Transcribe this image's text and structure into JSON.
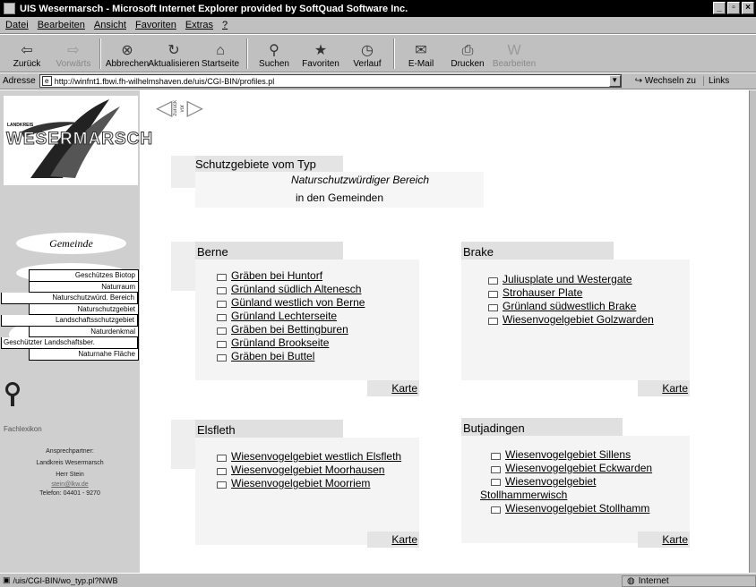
{
  "window": {
    "title": "UIS Wesermarsch - Microsoft Internet Explorer provided by SoftQuad Software Inc."
  },
  "menu": [
    "Datei",
    "Bearbeiten",
    "Ansicht",
    "Favoriten",
    "Extras",
    "?"
  ],
  "toolbar": [
    {
      "label": "Zurück",
      "icon": "back-arrow-icon",
      "glyph": "⇦",
      "enabled": true
    },
    {
      "label": "Vorwärts",
      "icon": "forward-arrow-icon",
      "glyph": "⇨",
      "enabled": false
    },
    {
      "label": "Abbrechen",
      "icon": "stop-icon",
      "glyph": "⊗",
      "enabled": true
    },
    {
      "label": "Aktualisieren",
      "icon": "refresh-icon",
      "glyph": "↻",
      "enabled": true
    },
    {
      "label": "Startseite",
      "icon": "home-icon",
      "glyph": "⌂",
      "enabled": true
    },
    {
      "label": "Suchen",
      "icon": "search-icon",
      "glyph": "⚲",
      "enabled": true
    },
    {
      "label": "Favoriten",
      "icon": "favorites-icon",
      "glyph": "★",
      "enabled": true
    },
    {
      "label": "Verlauf",
      "icon": "history-icon",
      "glyph": "◷",
      "enabled": true
    },
    {
      "label": "E-Mail",
      "icon": "mail-icon",
      "glyph": "✉",
      "enabled": true
    },
    {
      "label": "Drucken",
      "icon": "print-icon",
      "glyph": "⎙",
      "enabled": true
    },
    {
      "label": "Bearbeiten",
      "icon": "edit-icon",
      "glyph": "W",
      "enabled": false
    }
  ],
  "address": {
    "label": "Adresse",
    "url": "http://winfnt1.fbwi.fh-wilhelmshaven.de/uis/CGI-BIN/profiles.pl",
    "go": "Wechseln zu",
    "links": "Links"
  },
  "status": {
    "text": "/uis/CGI-BIN/wo_typ.pl?NWB",
    "zone": "Internet"
  },
  "sidebar": {
    "logo_small": "LANDKREIS",
    "logo": "WESERMARSCH",
    "gemeinde": "Gemeinde",
    "types": [
      "Geschützes Biotop",
      "Naturraum",
      "Naturschutzwürd. Bereich",
      "Naturschutzgebiet",
      "Landschaftsschutzgebiet",
      "Naturdenkmal",
      "Geschützter Landschaftsber.",
      "Naturnahe Fläche"
    ],
    "fachlexikon": "Fachlexikon",
    "contact": {
      "label": "Ansprechpartner:",
      "org": "Landkreis Wesermarsch",
      "person": "Herr Stein",
      "email": "stein@lkw.de",
      "phone": "Telefon: 04401 - 9270"
    }
  },
  "nav": {
    "back": "zurück",
    "forward": "vor"
  },
  "header": {
    "title": "Schutzgebiete vom Typ",
    "type": "Naturschutzwürdiger Bereich",
    "suffix": "in den Gemeinden"
  },
  "karte_label": "Karte",
  "gemeinden": [
    {
      "name": "Berne",
      "items": [
        "Gräben bei Huntorf",
        "Grünland südlich Altenesch",
        "Günland westlich von Berne",
        "Grünland Lechterseite",
        "Gräben bei Bettingburen",
        "Grünland Brookseite",
        "Gräben bei Buttel"
      ]
    },
    {
      "name": "Brake",
      "items": [
        "Juliusplate und Westergate",
        "Strohauser Plate",
        "Grünland südwestlich Brake",
        "Wiesenvogelgebiet Golzwarden"
      ]
    },
    {
      "name": "Elsfleth",
      "items": [
        "Wiesenvogelgebiet westlich Elsfleth",
        "Wiesenvogelgebiet Moorhausen",
        "Wiesenvogelgebiet Moorriem"
      ]
    },
    {
      "name": "Butjadingen",
      "items": [
        "Wiesenvogelgebiet Sillens",
        "Wiesenvogelgebiet Eckwarden",
        "Wiesenvogelgebiet Stollhammerwisch",
        "Wiesenvogelgebiet Stollhamm"
      ]
    }
  ]
}
